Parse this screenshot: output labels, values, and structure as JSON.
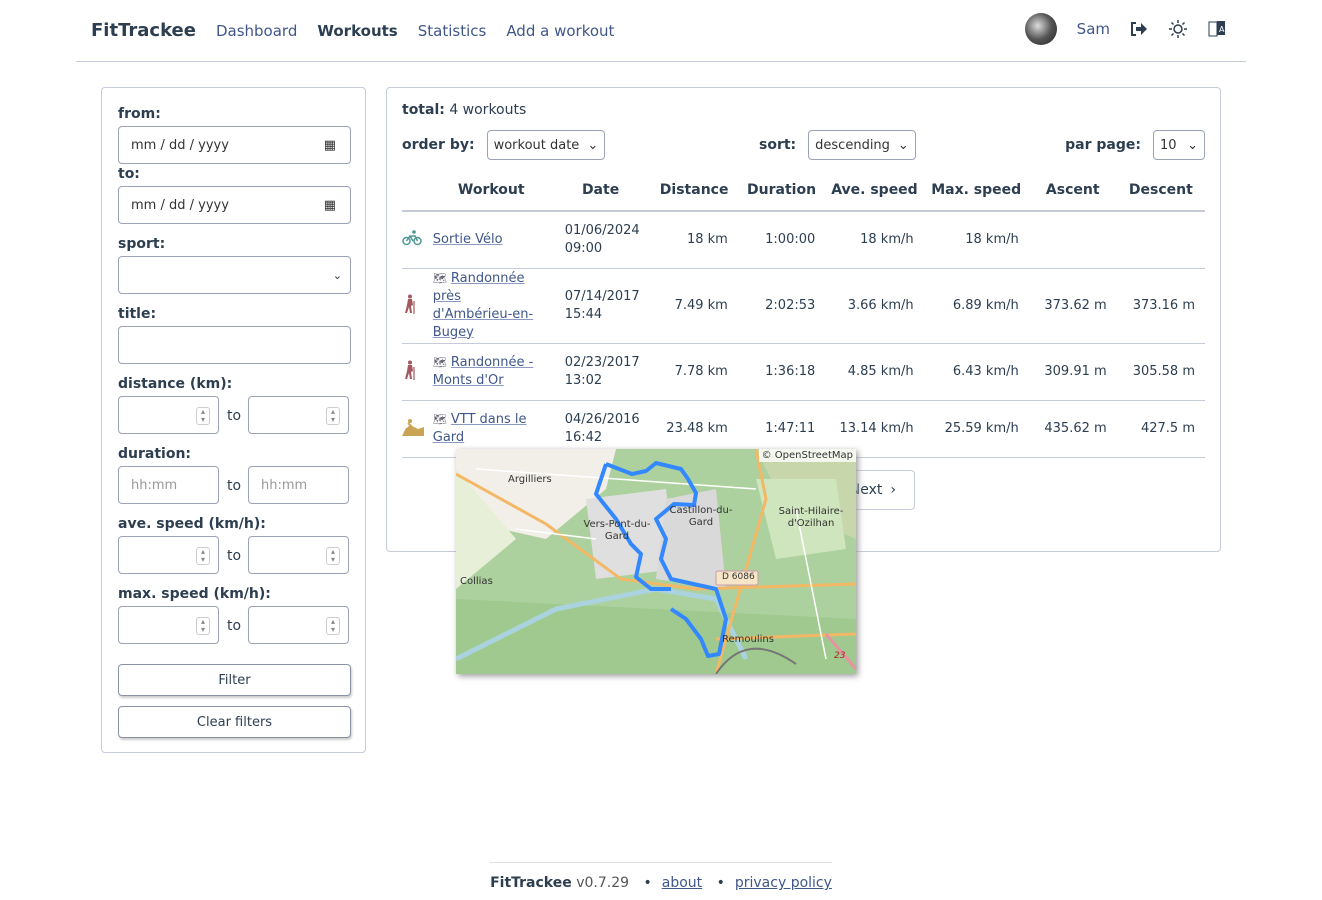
{
  "nav": {
    "brand": "FitTrackee",
    "links": [
      "Dashboard",
      "Workouts",
      "Statistics",
      "Add a workout"
    ],
    "active": "Workouts",
    "user": "Sam"
  },
  "filters": {
    "from_label": "from:",
    "from_placeholder": "mm / dd / yyyy",
    "to_label": "to:",
    "to_placeholder": "mm / dd / yyyy",
    "sport_label": "sport:",
    "title_label": "title:",
    "distance_label": "distance (km):",
    "duration_label": "duration:",
    "duration_placeholder": "hh:mm",
    "ave_speed_label": "ave. speed (km/h):",
    "max_speed_label": "max. speed (km/h):",
    "to_word": "to",
    "filter_button": "Filter",
    "clear_button": "Clear filters"
  },
  "list": {
    "total_label": "total:",
    "total_value": "4 workouts",
    "order_by_label": "order by:",
    "order_by_value": "workout date",
    "sort_label": "sort:",
    "sort_value": "descending",
    "per_page_label": "par page:",
    "per_page_value": "10",
    "columns": [
      "Workout",
      "Date",
      "Distance",
      "Duration",
      "Ave. speed",
      "Max. speed",
      "Ascent",
      "Descent"
    ],
    "rows": [
      {
        "sport": "cycling",
        "title": "Sortie Vélo",
        "has_map": false,
        "date": "01/06/2024",
        "time": "09:00",
        "distance": "18 km",
        "duration": "1:00:00",
        "ave": "18 km/h",
        "max": "18 km/h",
        "ascent": "",
        "descent": ""
      },
      {
        "sport": "hiking",
        "title": "Randonnée près d'Ambérieu-en-Bugey",
        "has_map": true,
        "date": "07/14/2017",
        "time": "15:44",
        "distance": "7.49 km",
        "duration": "2:02:53",
        "ave": "3.66 km/h",
        "max": "6.89 km/h",
        "ascent": "373.62 m",
        "descent": "373.16 m"
      },
      {
        "sport": "hiking",
        "title": "Randonnée - Monts d'Or",
        "has_map": true,
        "date": "02/23/2017",
        "time": "13:02",
        "distance": "7.78 km",
        "duration": "1:36:18",
        "ave": "4.85 km/h",
        "max": "6.43 km/h",
        "ascent": "309.91 m",
        "descent": "305.58 m"
      },
      {
        "sport": "mountain-biking",
        "title": "VTT dans le Gard",
        "has_map": true,
        "date": "04/26/2016",
        "time": "16:42",
        "distance": "23.48 km",
        "duration": "1:47:11",
        "ave": "13.14 km/h",
        "max": "25.59 km/h",
        "ascent": "435.62 m",
        "descent": "427.5 m"
      }
    ],
    "next_label": "Next"
  },
  "map": {
    "attribution": "© OpenStreetMap",
    "labels": [
      "Argilliers",
      "Vers-Pont-du-Gard",
      "Castillon-du-Gard",
      "Saint-Hilaire-d'Ozilhan",
      "Collias",
      "D 6086",
      "Remoulins",
      "23"
    ]
  },
  "footer": {
    "brand": "FitTrackee",
    "version": "v0.7.29",
    "about": "about",
    "privacy": "privacy policy"
  },
  "colors": {
    "cycling": "#4c9792",
    "hiking": "#a3595f",
    "mountain-biking": "#c9a454",
    "route": "#3388ff"
  }
}
